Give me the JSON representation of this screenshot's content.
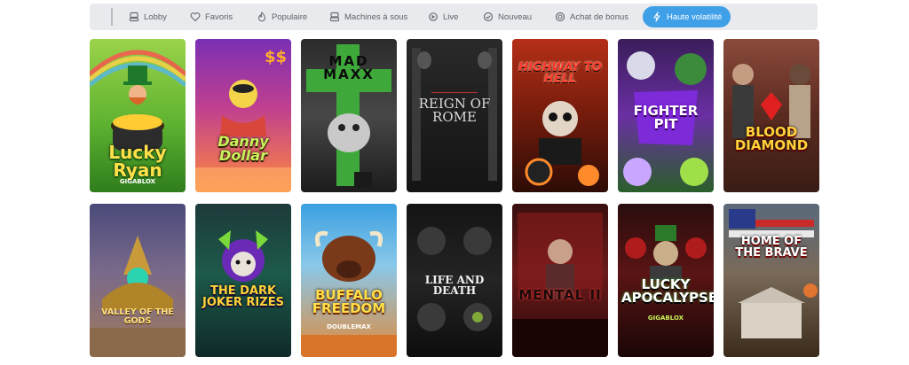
{
  "nav": {
    "items": [
      {
        "label": "Lobby",
        "icon": "lobby-icon"
      },
      {
        "label": "Favoris",
        "icon": "heart-icon"
      },
      {
        "label": "Populaire",
        "icon": "flame-icon"
      },
      {
        "label": "Machines à sous",
        "icon": "slot-machine-icon"
      },
      {
        "label": "Live",
        "icon": "live-icon"
      },
      {
        "label": "Nouveau",
        "icon": "check-badge-icon"
      },
      {
        "label": "Achat de bonus",
        "icon": "bonus-coin-icon"
      },
      {
        "label": "Haute volatilité",
        "icon": "lightning-icon"
      }
    ],
    "active_color": "#3fa0e8"
  },
  "games": {
    "row1": [
      {
        "title": "Lucky Ryan",
        "sub": "GIGABLOX"
      },
      {
        "title": "Danny Dollar",
        "sub": ""
      },
      {
        "title": "MAD MAXX",
        "sub": ""
      },
      {
        "title": "REIGN OF ROME",
        "sub": ""
      },
      {
        "title": "HIGHWAY TO HELL",
        "sub": ""
      },
      {
        "title": "FIGHTER PIT",
        "sub": ""
      },
      {
        "title": "BLOOD DIAMOND",
        "sub": ""
      }
    ],
    "row2": [
      {
        "title": "VALLEY OF THE GODS",
        "sub": ""
      },
      {
        "title": "THE DARK JOKER RIZES",
        "sub": ""
      },
      {
        "title": "BUFFALO FREEDOM",
        "sub": "DOUBLEMAX"
      },
      {
        "title": "LIFE AND DEATH",
        "sub": ""
      },
      {
        "title": "MENTAL II",
        "sub": ""
      },
      {
        "title": "LUCKY APOCALYPSE",
        "sub": "GIGABLOX"
      },
      {
        "title": "HOME OF THE BRAVE",
        "sub": ""
      }
    ]
  }
}
